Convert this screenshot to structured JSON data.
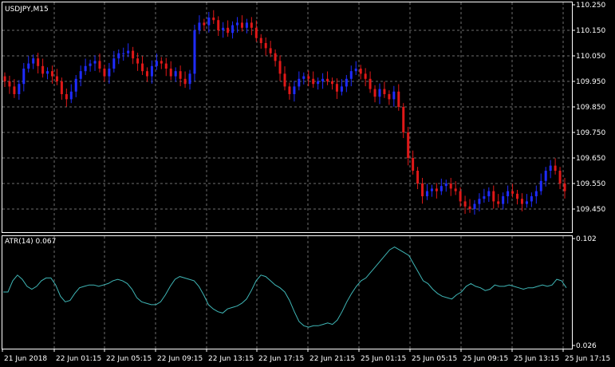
{
  "window": {
    "symbol_label": "USDJPY,M15",
    "indicator_label": "ATR(14) 0.067"
  },
  "colors": {
    "background": "#000000",
    "grid": "#6e6e6e",
    "frame": "#ffffff",
    "bull": "#1f2cff",
    "bear": "#e01818",
    "atr_line": "#3fb6b6",
    "text": "#ffffff"
  },
  "chart_data": [
    {
      "type": "candlestick",
      "title": "USDJPY,M15",
      "y_ticks": [
        "110.250",
        "110.150",
        "110.050",
        "109.950",
        "109.850",
        "109.750",
        "109.650",
        "109.550",
        "109.450"
      ],
      "ylim": [
        109.37,
        110.25
      ],
      "x_ticks": [
        "21 Jun 2018",
        "22 Jun 01:15",
        "22 Jun 05:15",
        "22 Jun 09:15",
        "22 Jun 13:15",
        "22 Jun 17:15",
        "22 Jun 21:15",
        "25 Jun 01:15",
        "25 Jun 05:15",
        "25 Jun 09:15",
        "25 Jun 13:15",
        "25 Jun 17:15"
      ],
      "grid": true,
      "series": [
        {
          "values": [
            109.95,
            109.93,
            109.9,
            109.94,
            110.0,
            110.02,
            110.04,
            110.01,
            109.98,
            109.99,
            109.97,
            109.95,
            109.9,
            109.88,
            109.91,
            109.96,
            109.99,
            110.01,
            110.02,
            110.03,
            110.0,
            109.97,
            110.0,
            110.04,
            110.06,
            110.06,
            110.07,
            110.04,
            110.02,
            109.99,
            109.97,
            110.01,
            110.03,
            110.02,
            110.0,
            109.97,
            109.99,
            109.96,
            109.94,
            109.98,
            110.15,
            110.18,
            110.17,
            110.2,
            110.19,
            110.15,
            110.16,
            110.14,
            110.17,
            110.18,
            110.16,
            110.18,
            110.16,
            110.12,
            110.1,
            110.08,
            110.06,
            110.03,
            109.98,
            109.93,
            109.9,
            109.93,
            109.96,
            109.97,
            109.96,
            109.94,
            109.95,
            109.96,
            109.95,
            109.94,
            109.91,
            109.93,
            109.96,
            109.99,
            110.0,
            109.98,
            109.96,
            109.92,
            109.89,
            109.92,
            109.9,
            109.88,
            109.91,
            109.85,
            109.75,
            109.65,
            109.6,
            109.55,
            109.5,
            109.52,
            109.53,
            109.52,
            109.54,
            109.55,
            109.53,
            109.52,
            109.48,
            109.46,
            109.45,
            109.47,
            109.49,
            109.5,
            109.52,
            109.48,
            109.47,
            109.5,
            109.52,
            109.51,
            109.49,
            109.47,
            109.48,
            109.5,
            109.52,
            109.56,
            109.6,
            109.62,
            109.6,
            109.55,
            109.52
          ]
        }
      ]
    },
    {
      "type": "line",
      "title": "ATR(14) 0.067",
      "y_ticks": [
        "0.102",
        "0.026"
      ],
      "ylim": [
        0.026,
        0.102
      ],
      "grid": true,
      "series": [
        {
          "values": [
            0.064,
            0.064,
            0.072,
            0.076,
            0.073,
            0.068,
            0.066,
            0.068,
            0.072,
            0.074,
            0.074,
            0.069,
            0.061,
            0.057,
            0.058,
            0.063,
            0.067,
            0.068,
            0.069,
            0.069,
            0.068,
            0.069,
            0.07,
            0.072,
            0.073,
            0.072,
            0.07,
            0.066,
            0.06,
            0.057,
            0.056,
            0.055,
            0.055,
            0.057,
            0.062,
            0.068,
            0.073,
            0.075,
            0.074,
            0.073,
            0.072,
            0.068,
            0.062,
            0.055,
            0.052,
            0.05,
            0.049,
            0.052,
            0.053,
            0.054,
            0.056,
            0.059,
            0.065,
            0.072,
            0.076,
            0.075,
            0.072,
            0.069,
            0.067,
            0.064,
            0.058,
            0.05,
            0.043,
            0.04,
            0.039,
            0.04,
            0.04,
            0.041,
            0.042,
            0.041,
            0.044,
            0.05,
            0.057,
            0.063,
            0.068,
            0.072,
            0.074,
            0.078,
            0.082,
            0.086,
            0.09,
            0.094,
            0.096,
            0.094,
            0.092,
            0.09,
            0.084,
            0.078,
            0.072,
            0.07,
            0.066,
            0.063,
            0.061,
            0.06,
            0.059,
            0.062,
            0.064,
            0.068,
            0.07,
            0.068,
            0.067,
            0.065,
            0.066,
            0.069,
            0.068,
            0.068,
            0.069,
            0.068,
            0.067,
            0.066,
            0.067,
            0.067,
            0.068,
            0.069,
            0.068,
            0.069,
            0.073,
            0.072,
            0.067
          ]
        }
      ]
    }
  ]
}
